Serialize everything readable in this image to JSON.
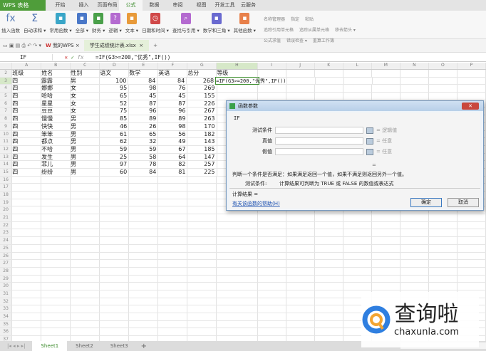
{
  "app": {
    "logo": "WPS 表格",
    "menu_tabs": [
      "开始",
      "插入",
      "页面布局",
      "公式",
      "数据",
      "审阅",
      "视图",
      "开发工具",
      "云服务"
    ],
    "active_tab": "公式"
  },
  "ribbon": {
    "buttons": [
      {
        "label": "插入函数",
        "icon": "fx",
        "color": "#5a7fb8"
      },
      {
        "label": "自动求和 ▾",
        "icon": "Σ",
        "color": "#4a6fb0"
      },
      {
        "label": "常用函数 ▾",
        "icon": "▪",
        "color": "#3aa6c8"
      },
      {
        "label": "全部 ▾",
        "icon": "▪",
        "color": "#4a78c8"
      },
      {
        "label": "财务 ▾",
        "icon": "▪",
        "color": "#4aa04a"
      },
      {
        "label": "逻辑 ▾",
        "icon": "?",
        "color": "#b46ad0"
      },
      {
        "label": "文本 ▾",
        "icon": "▪",
        "color": "#e89a3a"
      },
      {
        "label": "日期和时间 ▾",
        "icon": "◷",
        "color": "#d04848"
      },
      {
        "label": "查找与引用 ▾",
        "icon": "⌕",
        "color": "#b46ad0"
      },
      {
        "label": "数学和三角 ▾",
        "icon": "▪",
        "color": "#6a6ad0"
      },
      {
        "label": "其他函数 ▾",
        "icon": "▪",
        "color": "#e8804a"
      }
    ],
    "small": [
      "名称管理器",
      "指定",
      "粘贴",
      "追踪引用单元格",
      "追踪从属单元格",
      "移去箭头 ▾",
      "公式求值",
      "错误检查 ▾",
      "重算工作簿"
    ]
  },
  "quick": {
    "my_wps": "我的WPS",
    "doc_tab": "学生成绩统计表.xlsx"
  },
  "formula_bar": {
    "name_box": "IF",
    "formula": "=IF(G3>=200,\"优秀\",IF())"
  },
  "columns": [
    "A",
    "B",
    "C",
    "D",
    "E",
    "F",
    "G",
    "H",
    "I",
    "J",
    "K",
    "L",
    "M",
    "N",
    "O",
    "P"
  ],
  "header_row": [
    "班级",
    "姓名",
    "性别",
    "语文",
    "数学",
    "英语",
    "总分",
    "等级"
  ],
  "rows": [
    [
      "四",
      "露露",
      "男",
      "100",
      "84",
      "84",
      "268"
    ],
    [
      "四",
      "娜娜",
      "女",
      "95",
      "98",
      "76",
      "269"
    ],
    [
      "四",
      "哈哈",
      "女",
      "65",
      "45",
      "45",
      "155"
    ],
    [
      "四",
      "星星",
      "女",
      "52",
      "87",
      "87",
      "226"
    ],
    [
      "四",
      "豆豆",
      "女",
      "75",
      "96",
      "96",
      "267"
    ],
    [
      "四",
      "慢慢",
      "男",
      "85",
      "89",
      "89",
      "263"
    ],
    [
      "四",
      "快快",
      "男",
      "46",
      "26",
      "98",
      "170"
    ],
    [
      "四",
      "笨笨",
      "男",
      "61",
      "65",
      "56",
      "182"
    ],
    [
      "四",
      "都点",
      "男",
      "62",
      "32",
      "49",
      "143"
    ],
    [
      "四",
      "不哈",
      "男",
      "59",
      "59",
      "67",
      "185"
    ],
    [
      "四",
      "发生",
      "男",
      "25",
      "58",
      "64",
      "147"
    ],
    [
      "四",
      "菲儿",
      "男",
      "97",
      "78",
      "82",
      "257"
    ],
    [
      "四",
      "纷纷",
      "男",
      "60",
      "84",
      "81",
      "225"
    ]
  ],
  "dialog": {
    "title": "函数参数",
    "func": "IF",
    "args": [
      {
        "label": "测试条件",
        "hint": "= 逻辑值"
      },
      {
        "label": "真值",
        "hint": "= 任意"
      },
      {
        "label": "假值",
        "hint": "= 任意"
      }
    ],
    "eq": "=",
    "desc": "判断一个条件是否满足：如果满足返回一个值，如果不满足则返回另外一个值。",
    "arg_desc_label": "测试条件:",
    "arg_desc": "计算结果可判断为 TRUE 或 FALSE 的数值或表达式",
    "result_label": "计算结果 =",
    "help_link": "有关该函数的帮助(H)",
    "ok": "确定",
    "cancel": "取消"
  },
  "sheets": [
    "Sheet1",
    "Sheet2",
    "Sheet3"
  ],
  "watermark": {
    "text": "查询啦",
    "domain": "chaxunla.com"
  }
}
